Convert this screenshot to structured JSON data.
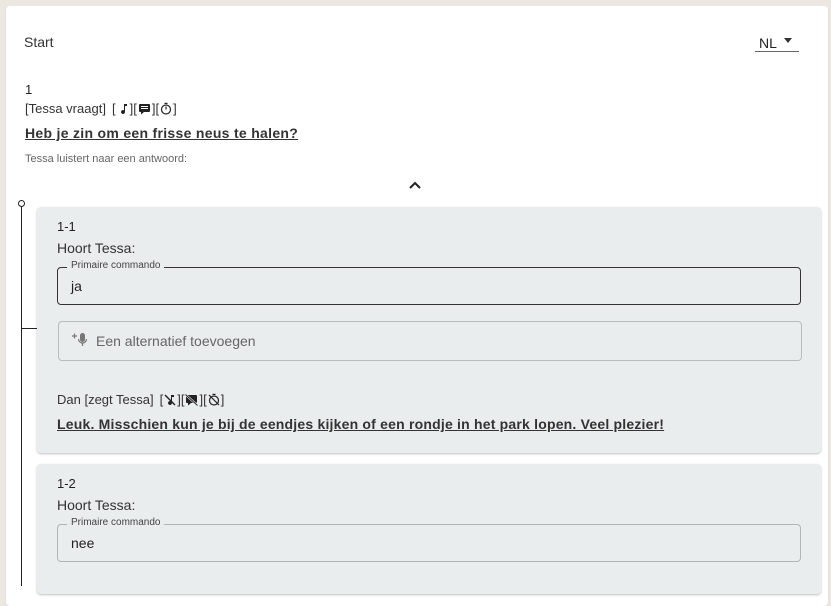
{
  "header": {
    "start": "Start",
    "language": "NL"
  },
  "node": {
    "number": "1",
    "asks_label": "[Tessa vraagt]",
    "question": "Heb je zin om een frisse neus te halen?",
    "listens_label": "Tessa luistert naar een antwoord:"
  },
  "answers": [
    {
      "id": "1-1",
      "hears_label": "Hoort Tessa:",
      "primary_legend": "Primaire commando",
      "primary_value": "ja",
      "alt_placeholder": "Een alternatief toevoegen",
      "then_label": "Dan [zegt Tessa]",
      "response": "Leuk. Misschien kun je bij de eendjes kijken of een rondje in het park lopen. Veel plezier!"
    },
    {
      "id": "1-2",
      "hears_label": "Hoort Tessa:",
      "primary_legend": "Primaire commando",
      "primary_value": "nee"
    }
  ]
}
